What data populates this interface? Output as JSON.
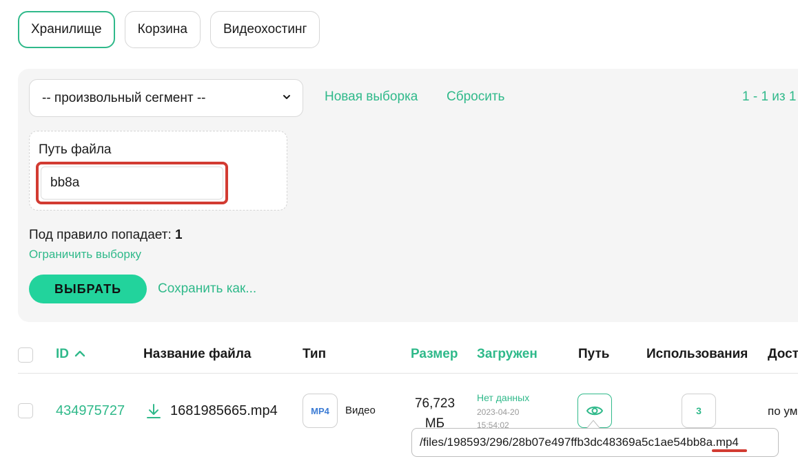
{
  "tabs": [
    {
      "label": "Хранилище",
      "active": true
    },
    {
      "label": "Корзина",
      "active": false
    },
    {
      "label": "Видеохостинг",
      "active": false
    }
  ],
  "filters": {
    "segment_selected": "-- произвольный сегмент --",
    "new_selection": "Новая выборка",
    "reset": "Сбросить",
    "pagination": "1 - 1 из 1",
    "path_label": "Путь файла",
    "path_value": "bb8a",
    "match_label": "Под правило попадает:",
    "match_count": "1",
    "limit_link": "Ограничить выборку",
    "choose_button": "ВЫБРАТЬ",
    "save_as": "Сохранить как..."
  },
  "table": {
    "headers": {
      "id": "ID",
      "name": "Название файла",
      "type": "Тип",
      "size": "Размер",
      "uploaded": "Загружен",
      "path": "Путь",
      "uses": "Использования",
      "access": "Дост"
    },
    "rows": [
      {
        "id": "434975727",
        "name": "1681985665.mp4",
        "type_badge": "MP4",
        "type_text": "Видео",
        "size_value": "76,723",
        "size_unit": "МБ",
        "uploaded_status": "Нет данных",
        "uploaded_date": "2023-04-20",
        "uploaded_time": "15:54:02",
        "uses": "3",
        "access": "по ум"
      }
    ]
  },
  "tooltip": {
    "path_prefix": "/files/198593/296/28b07e497ffb3dc48369a5c1ae54",
    "path_match": "bb8a",
    "path_suffix": ".mp4"
  },
  "colors": {
    "accent": "#2fb98a",
    "button": "#22d39c",
    "highlight": "#d23b32",
    "panel": "#f5f5f5"
  },
  "icons": {
    "select_chevron": "chevron-down-icon",
    "sort": "chevron-up-icon",
    "download": "download-icon",
    "path": "eye-icon"
  }
}
